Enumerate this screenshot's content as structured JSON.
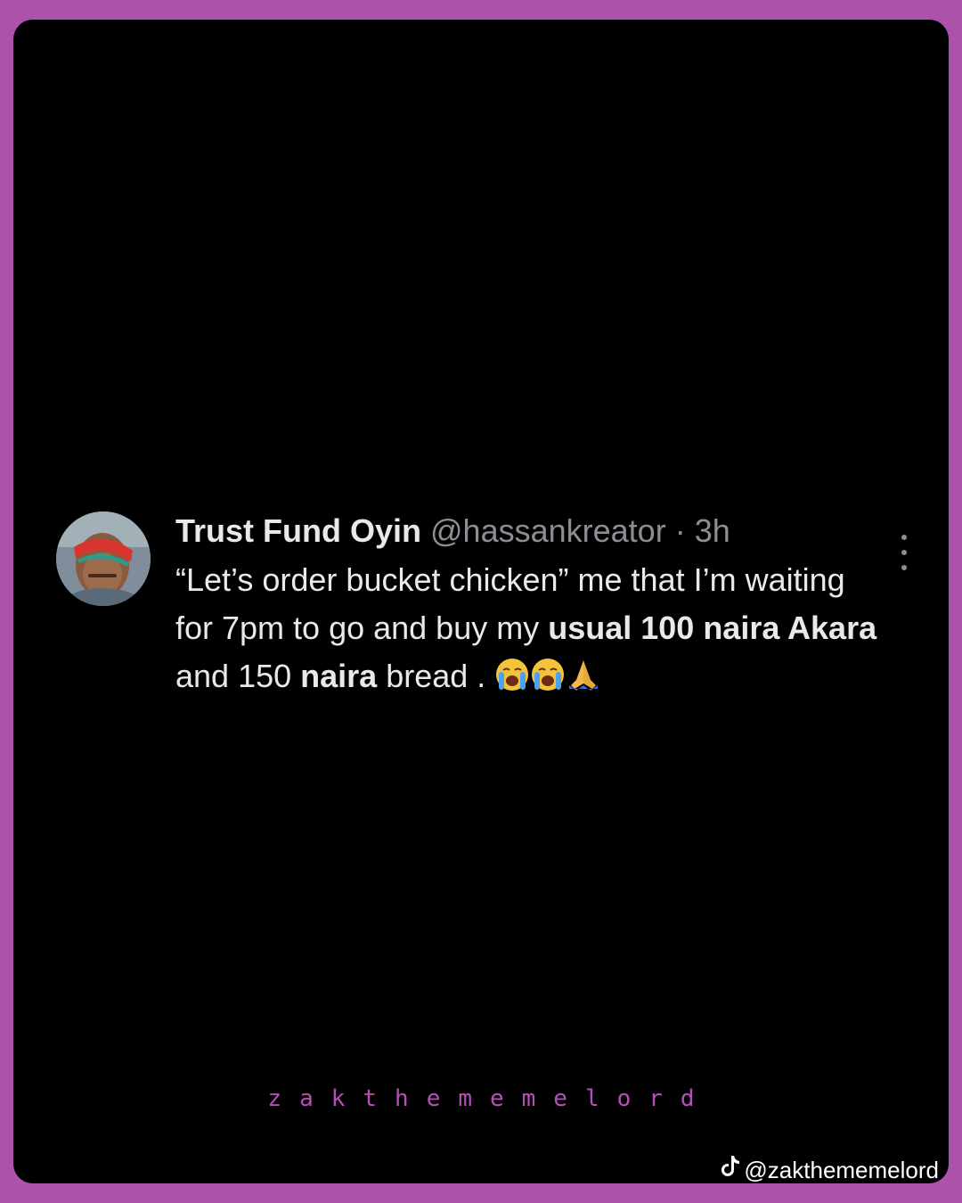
{
  "tweet": {
    "display_name": "Trust Fund Oyin",
    "handle": "@hassankreator",
    "separator": "·",
    "time": "3h",
    "text_part1": "“Let’s order bucket chicken” me that I’m waiting for 7pm to go and buy my ",
    "bold1": "usual 100 naira Akara",
    "text_part2": " and 150 ",
    "bold2": "naira",
    "text_part3": " bread .",
    "emojis": [
      "crying-face-icon",
      "crying-face-icon",
      "folded-hands-icon"
    ]
  },
  "watermark": {
    "center_text": "zakthememelord",
    "corner_icon": "tiktok-icon",
    "corner_text": "@zakthememelord"
  },
  "colors": {
    "frame": "#ad52ab",
    "card": "#000000",
    "text": "#e7e9ea",
    "muted": "#8b8f94",
    "watermark": "#b84fb6"
  }
}
